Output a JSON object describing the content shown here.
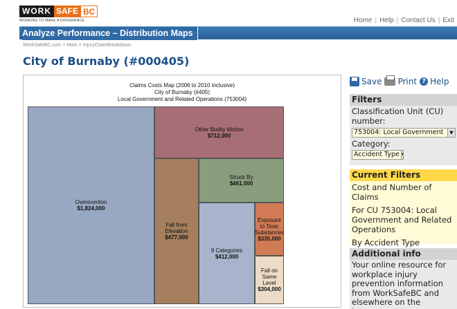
{
  "header": {
    "logo_work": "WORK",
    "logo_safe": "SAFE",
    "logo_bc": "BC",
    "logo_tagline": "WORKING TO MAKE A DIFFERENCE",
    "nav": [
      "Home",
      "Help",
      "Contact Us",
      "Exit"
    ]
  },
  "banner": {
    "title": "Analyze Performance – Distribution Maps"
  },
  "breadcrumb": "WorkSafeBC.com > Main > InjuryClaimBreakdown",
  "page_title": "City of Burnaby  (#000405)",
  "map": {
    "title_line1": "Claims Costs Map (2006 to 2010 inclusive)",
    "title_line2": "City of Burnaby (#405)",
    "title_line3": "Local Government and Related Operations (753004)",
    "tiles": [
      {
        "label": "Overexertion",
        "value": "$1,824,000",
        "color": "#98a7c2"
      },
      {
        "label": "Other Bodily Motion",
        "value": "$712,000",
        "color": "#a86e76"
      },
      {
        "label": "Fall from Elevation",
        "value": "$477,000",
        "color": "#a57f5e"
      },
      {
        "label": "Struck By",
        "value": "$461,000",
        "color": "#899e7c"
      },
      {
        "label": "9 Categories",
        "value": "$412,000",
        "color": "#a7b4cc"
      },
      {
        "label": "Exposure to Toxic Substances",
        "value": "$335,000",
        "color": "#d07b55"
      },
      {
        "label": "Fall on Same Level",
        "value": "$304,000",
        "color": "#ecdcc7"
      }
    ]
  },
  "sidebar": {
    "save": "Save",
    "print": "Print",
    "help": "Help",
    "filters_head": "Filters",
    "cu_label": "Classification Unit (CU) number:",
    "cu_value": "753004: Local Government",
    "category_label": "Category:",
    "category_value": "Accident Type",
    "current_head": "Current Filters",
    "current_1": "Cost and Number of Claims",
    "current_2": "For CU 753004: Local Government and Related Operations",
    "current_3": "By Accident Type",
    "info_head": "Additional info",
    "info_text": "Your online resource for workplace injury prevention information from WorkSafeBC and elsewhere on the internet."
  }
}
